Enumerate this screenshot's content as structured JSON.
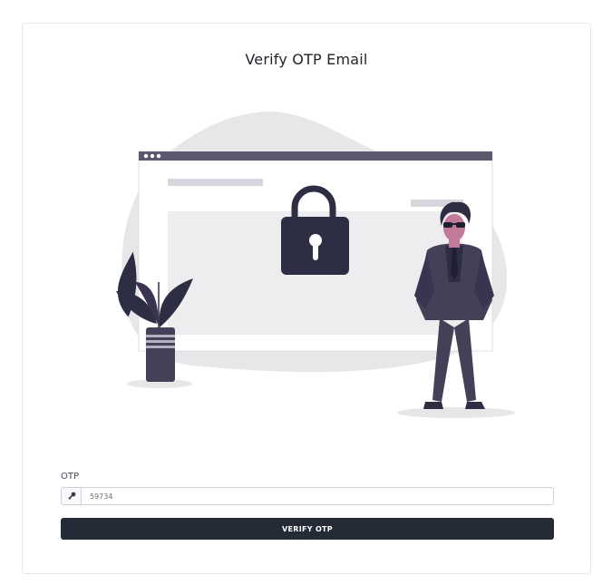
{
  "page": {
    "title": "Verify OTP Email"
  },
  "form": {
    "otp_label": "OTP",
    "otp_value": "59734",
    "otp_icon": "key-icon",
    "submit_label": "VERIFY OTP"
  },
  "illustration": {
    "subject": "locked-browser-window-with-agent",
    "colors": {
      "blob": "#e7e7ea",
      "browser_bar": "#5e586f",
      "lock": "#2d2e44",
      "suit": "#453f57",
      "skin": "#c27a9a",
      "placeholder": "#d6d6dc"
    }
  },
  "colors": {
    "button_bg": "#242b37",
    "button_text": "#ffffff",
    "border": "#e6e7ea"
  }
}
